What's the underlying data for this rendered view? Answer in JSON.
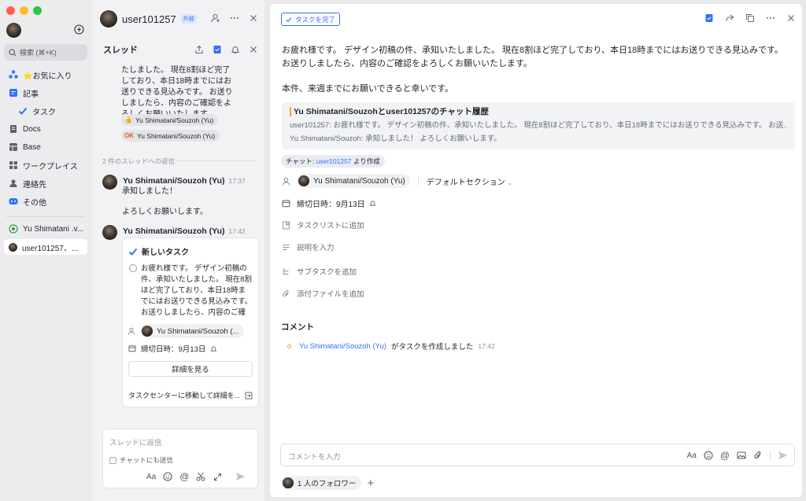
{
  "colors": {
    "accent": "#3370ff",
    "sidebar_bg": "#ececef",
    "thread_bg": "#f2f2f4",
    "close": "#ff5f57",
    "minimize": "#febc2e",
    "maximize": "#28c840"
  },
  "sidebar": {
    "search_placeholder": "検索 (⌘+K)",
    "items": [
      {
        "label": "⭐お気に入り",
        "icon": "favorites-icon"
      },
      {
        "label": "記事",
        "icon": "article-icon"
      },
      {
        "label": "タスク",
        "icon": "task-check-icon"
      },
      {
        "label": "Docs",
        "icon": "docs-icon"
      },
      {
        "label": "Base",
        "icon": "base-icon"
      },
      {
        "label": "ワークプレイス",
        "icon": "workplace-icon"
      },
      {
        "label": "連絡先",
        "icon": "contacts-icon"
      },
      {
        "label": "その他",
        "icon": "more-icon"
      }
    ],
    "chats": [
      {
        "label": "Yu Shimatani .v..."
      },
      {
        "label": "user101257、..."
      }
    ]
  },
  "thread": {
    "user": "user101257",
    "external_badge": "外部",
    "title": "スレッド",
    "message": "たしました。 現在8割ほど完了しており、本日18時までにはお送りできる見込みです。 お送りしましたら、内容のご確認をよろしくお願いいたします。",
    "reactions": [
      {
        "emoji": "👍",
        "name": "Yu Shimatani/Souzoh (Yu)"
      },
      {
        "emoji": "OK",
        "name": "Yu Shimatani/Souzoh (Yu)"
      }
    ],
    "replies_count": "2 件のスレッドへの返信",
    "reply1": {
      "name": "Yu Shimatani/Souzoh (Yu)",
      "time": "17:37",
      "line1": "承知しました！",
      "line2": "よろしくお願いします。"
    },
    "reply2": {
      "name": "Yu Shimatani/Souzoh (Yu)",
      "time": "17:42"
    },
    "task_card": {
      "title": "新しいタスク",
      "desc": "お疲れ様です。 デザイン初稿の件、承知いたしました。 現在8割ほど完了しており、本日18時までにはお送りできる見込みです。 お送りしましたら、内容のご確認...",
      "assignee": "Yu Shimatani/Souzoh (...",
      "due": "締切日時：9月13日",
      "detail_button": "詳細を見る",
      "task_center": "タスクセンターに移動して詳細を..."
    },
    "input_placeholder": "スレッドに返信",
    "also_send_chat": "チャットにも送信"
  },
  "main": {
    "done_button": "タスクを完了",
    "desc_line1": "お疲れ様です。 デザイン初稿の件、承知いたしました。 現在8割ほど完了しており、本日18時までにはお送りできる見込みです。 お送りしましたら、内容のご確認をよろしくお願いいたします。",
    "desc_line2": "本件、来週までにお願いできると幸いです。",
    "quote_title": "Yu Shimatani/Souzohとuser101257のチャット履歴",
    "quote_line1": "user101257: お疲れ様です。 デザイン初稿の件、承知いたしました。 現在8割ほど完了しており、本日18時までにはお送りできる見込みです。 お送…",
    "quote_line2": "Yu Shimatani/Souzoh: 承知しました！ よろしくお願いします。",
    "chat_tag_prefix": "チャット: ",
    "chat_tag_link": "user101257",
    "chat_tag_suffix": " より作成",
    "owner": "Yu Shimatani/Souzoh (Yu)",
    "section": "デフォルトセクション",
    "due": "締切日時：9月13日",
    "add_tasklist": "タスクリストに追加",
    "add_description": "説明を入力",
    "add_subtask": "サブタスクを追加",
    "add_attachment": "添付ファイルを追加",
    "comments_title": "コメント",
    "comment_user": "Yu Shimatani/Souzoh (Yu)",
    "comment_text": "がタスクを作成しました",
    "comment_time": "17:42",
    "comment_placeholder": "コメントを入力",
    "followers": "1 人のフォロワー",
    "add_follower": "+"
  }
}
